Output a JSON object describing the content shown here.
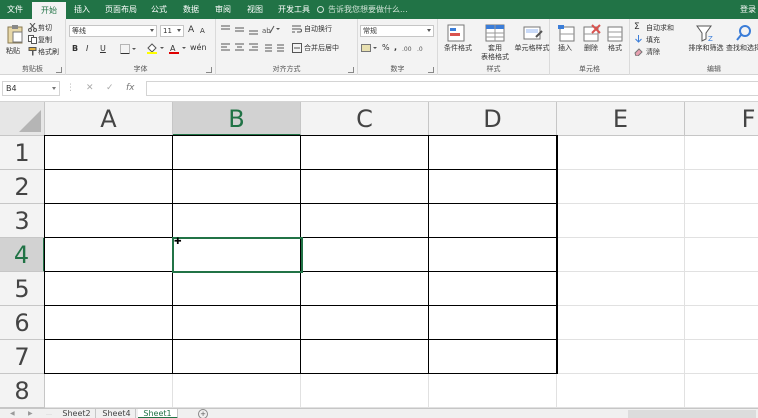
{
  "tabs": [
    {
      "label": "文件",
      "active": false
    },
    {
      "label": "开始",
      "active": true
    },
    {
      "label": "插入",
      "active": false
    },
    {
      "label": "页面布局",
      "active": false
    },
    {
      "label": "公式",
      "active": false
    },
    {
      "label": "数据",
      "active": false
    },
    {
      "label": "审阅",
      "active": false
    },
    {
      "label": "视图",
      "active": false
    },
    {
      "label": "开发工具",
      "active": false
    }
  ],
  "tell_me": "告诉我您想要做什么...",
  "login": "登录",
  "ribbon": {
    "clipboard": {
      "paste": "粘贴",
      "cut": "剪切",
      "copy": "复制",
      "format_painter": "格式刷",
      "label": "剪贴板"
    },
    "font": {
      "name": "等线",
      "size": "11",
      "bold": "B",
      "italic": "I",
      "underline": "U",
      "grow": "A",
      "shrink": "A",
      "label": "字体"
    },
    "alignment": {
      "wrap": "自动换行",
      "merge": "合并后居中",
      "label": "对齐方式"
    },
    "number": {
      "format": "常规",
      "percent": "%",
      "comma": ",",
      "label": "数字"
    },
    "styles": {
      "conditional": "条件格式",
      "table_line1": "套用",
      "table_line2": "表格格式",
      "cell_styles": "单元格样式",
      "label": "样式"
    },
    "cells": {
      "insert": "插入",
      "delete": "删除",
      "format": "格式",
      "label": "单元格"
    },
    "editing": {
      "autosum": "自动求和",
      "fill": "填充",
      "clear": "清除",
      "sort": "排序和筛选",
      "find": "查找和选择",
      "label": "编辑"
    }
  },
  "formula_bar": {
    "name_box": "B4",
    "cancel": "✕",
    "enter": "✓",
    "fx": "fx",
    "formula": ""
  },
  "grid": {
    "columns": [
      "A",
      "B",
      "C",
      "D",
      "E",
      "F"
    ],
    "rows": [
      "1",
      "2",
      "3",
      "4",
      "5",
      "6",
      "7",
      "8"
    ],
    "selected_column": "B",
    "selected_row": "4",
    "active_cell": "B4"
  },
  "sheets": [
    {
      "name": "Sheet2",
      "active": false
    },
    {
      "name": "Sheet4",
      "active": false
    },
    {
      "name": "Sheet1",
      "active": true
    }
  ],
  "add_sheet": "+",
  "colors": {
    "accent": "#217346",
    "ribbon_bg": "#f3f3f3",
    "header_bg": "#f3f3f3",
    "selected_header_bg": "#d2d2d2"
  }
}
